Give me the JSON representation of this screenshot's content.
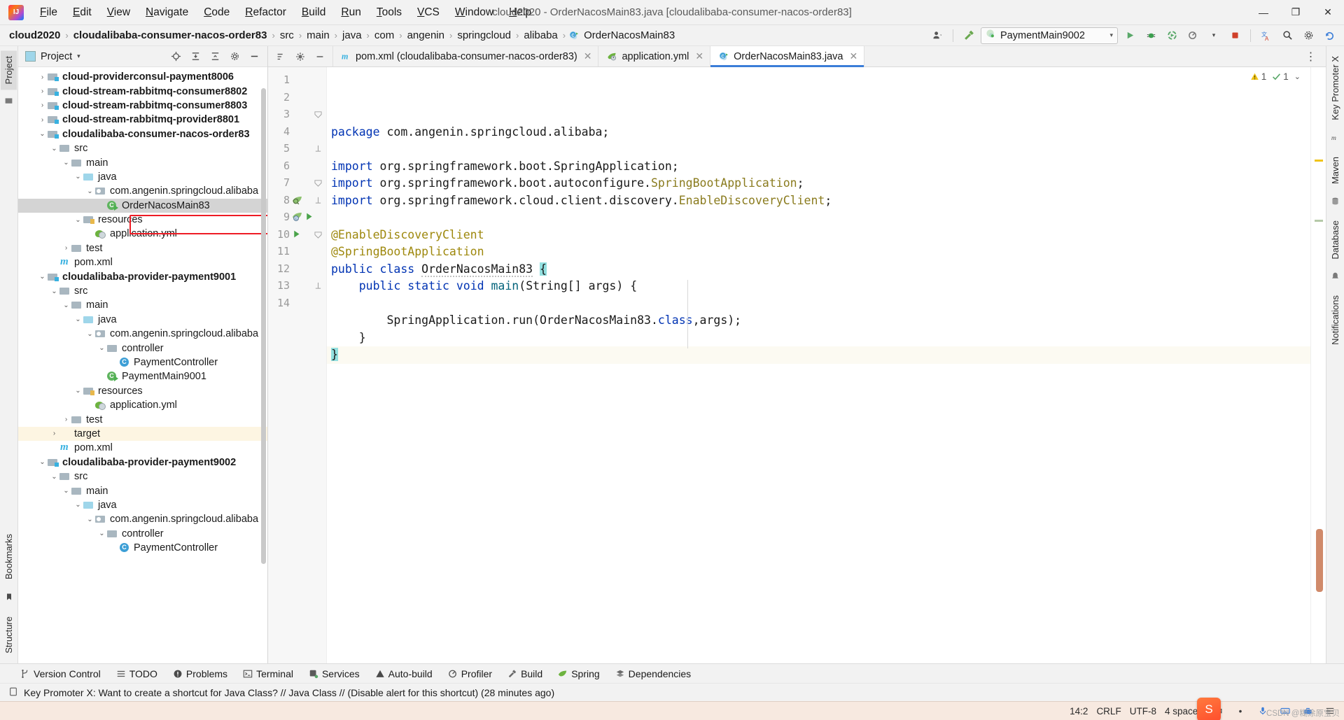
{
  "window": {
    "title": "cloud2020 - OrderNacosMain83.java [cloudalibaba-consumer-nacos-order83]",
    "minimize": "—",
    "maximize": "❐",
    "close": "✕",
    "logo_text": "IJ"
  },
  "menu": [
    {
      "label": "File"
    },
    {
      "label": "Edit"
    },
    {
      "label": "View"
    },
    {
      "label": "Navigate"
    },
    {
      "label": "Code"
    },
    {
      "label": "Refactor"
    },
    {
      "label": "Build"
    },
    {
      "label": "Run"
    },
    {
      "label": "Tools"
    },
    {
      "label": "VCS"
    },
    {
      "label": "Window"
    },
    {
      "label": "Help"
    }
  ],
  "breadcrumb": {
    "items": [
      {
        "label": "cloud2020",
        "bold": true
      },
      {
        "label": "cloudalibaba-consumer-nacos-order83",
        "bold": true
      },
      {
        "label": "src",
        "bold": false
      },
      {
        "label": "main",
        "bold": false
      },
      {
        "label": "java",
        "bold": false
      },
      {
        "label": "com",
        "bold": false
      },
      {
        "label": "angenin",
        "bold": false
      },
      {
        "label": "springcloud",
        "bold": false
      },
      {
        "label": "alibaba",
        "bold": false
      },
      {
        "label": "OrderNacosMain83",
        "bold": false
      }
    ],
    "separator": "›"
  },
  "toolbar": {
    "run_config": "PaymentMain9002",
    "run_config_caret": "▾",
    "user_icon": "user-account",
    "hammer_icon": "build-hammer",
    "run_icon": "▶",
    "debug_icon": "debug-bug",
    "coverage_icon": "run-with-coverage",
    "profiler_icon": "profiler",
    "stop_icon": "■",
    "translate_icon": "translate",
    "search_icon": "⌕",
    "settings_icon": "⚙",
    "updates_icon": "updates"
  },
  "left_strip": {
    "project_tab": "Project",
    "bookmarks_tab": "Bookmarks",
    "structure_tab": "Structure"
  },
  "right_strip": {
    "tabs": [
      "Key Promoter X",
      "Maven",
      "Database",
      "Notifications"
    ]
  },
  "project_panel": {
    "title": "Project",
    "caret": "▾",
    "tools": [
      "locate-icon",
      "expand-all-icon",
      "collapse-all-icon",
      "settings-icon",
      "hide-icon"
    ],
    "tree": [
      {
        "depth": 2,
        "arrow": "›",
        "icon": "module",
        "label": "cloud-providerconsul-payment8006",
        "bold": true
      },
      {
        "depth": 2,
        "arrow": "›",
        "icon": "module",
        "label": "cloud-stream-rabbitmq-consumer8802",
        "bold": true
      },
      {
        "depth": 2,
        "arrow": "›",
        "icon": "module",
        "label": "cloud-stream-rabbitmq-consumer8803",
        "bold": true
      },
      {
        "depth": 2,
        "arrow": "›",
        "icon": "module",
        "label": "cloud-stream-rabbitmq-provider8801",
        "bold": true
      },
      {
        "depth": 2,
        "arrow": "⌄",
        "icon": "module",
        "label": "cloudalibaba-consumer-nacos-order83",
        "bold": true
      },
      {
        "depth": 3,
        "arrow": "⌄",
        "icon": "folder",
        "label": "src",
        "bold": false
      },
      {
        "depth": 4,
        "arrow": "⌄",
        "icon": "folder",
        "label": "main",
        "bold": false
      },
      {
        "depth": 5,
        "arrow": "⌄",
        "icon": "src",
        "label": "java",
        "bold": false
      },
      {
        "depth": 6,
        "arrow": "⌄",
        "icon": "pkg",
        "label": "com.angenin.springcloud.alibaba",
        "bold": false
      },
      {
        "depth": 7,
        "arrow": "",
        "icon": "springcls",
        "label": "OrderNacosMain83",
        "bold": false,
        "selected": true,
        "boxed": true
      },
      {
        "depth": 5,
        "arrow": "⌄",
        "icon": "res",
        "label": "resources",
        "bold": false
      },
      {
        "depth": 6,
        "arrow": "",
        "icon": "yml",
        "label": "application.yml",
        "bold": false
      },
      {
        "depth": 4,
        "arrow": "›",
        "icon": "folder",
        "label": "test",
        "bold": false
      },
      {
        "depth": 3,
        "arrow": "",
        "icon": "mvn",
        "label": "pom.xml",
        "bold": false
      },
      {
        "depth": 2,
        "arrow": "⌄",
        "icon": "module",
        "label": "cloudalibaba-provider-payment9001",
        "bold": true
      },
      {
        "depth": 3,
        "arrow": "⌄",
        "icon": "folder",
        "label": "src",
        "bold": false
      },
      {
        "depth": 4,
        "arrow": "⌄",
        "icon": "folder",
        "label": "main",
        "bold": false
      },
      {
        "depth": 5,
        "arrow": "⌄",
        "icon": "src",
        "label": "java",
        "bold": false
      },
      {
        "depth": 6,
        "arrow": "⌄",
        "icon": "pkg",
        "label": "com.angenin.springcloud.alibaba",
        "bold": false
      },
      {
        "depth": 7,
        "arrow": "⌄",
        "icon": "folder",
        "label": "controller",
        "bold": false
      },
      {
        "depth": 8,
        "arrow": "",
        "icon": "cls",
        "label": "PaymentController",
        "bold": false
      },
      {
        "depth": 7,
        "arrow": "",
        "icon": "springcls",
        "label": "PaymentMain9001",
        "bold": false
      },
      {
        "depth": 5,
        "arrow": "⌄",
        "icon": "res",
        "label": "resources",
        "bold": false
      },
      {
        "depth": 6,
        "arrow": "",
        "icon": "yml",
        "label": "application.yml",
        "bold": false
      },
      {
        "depth": 4,
        "arrow": "›",
        "icon": "folder",
        "label": "test",
        "bold": false
      },
      {
        "depth": 3,
        "arrow": "›",
        "icon": "target",
        "label": "target",
        "bold": false,
        "highlight": true
      },
      {
        "depth": 3,
        "arrow": "",
        "icon": "mvn",
        "label": "pom.xml",
        "bold": false
      },
      {
        "depth": 2,
        "arrow": "⌄",
        "icon": "module",
        "label": "cloudalibaba-provider-payment9002",
        "bold": true
      },
      {
        "depth": 3,
        "arrow": "⌄",
        "icon": "folder",
        "label": "src",
        "bold": false
      },
      {
        "depth": 4,
        "arrow": "⌄",
        "icon": "folder",
        "label": "main",
        "bold": false
      },
      {
        "depth": 5,
        "arrow": "⌄",
        "icon": "src",
        "label": "java",
        "bold": false
      },
      {
        "depth": 6,
        "arrow": "⌄",
        "icon": "pkg",
        "label": "com.angenin.springcloud.alibaba",
        "bold": false
      },
      {
        "depth": 7,
        "arrow": "⌄",
        "icon": "folder",
        "label": "controller",
        "bold": false
      },
      {
        "depth": 8,
        "arrow": "",
        "icon": "cls",
        "label": "PaymentController",
        "bold": false
      }
    ]
  },
  "editor": {
    "tabs": [
      {
        "label": "pom.xml (cloudalibaba-consumer-nacos-order83)",
        "icon": "maven-icon",
        "active": false,
        "close": "✕"
      },
      {
        "label": "application.yml",
        "icon": "spring-yaml-icon",
        "active": false,
        "close": "✕"
      },
      {
        "label": "OrderNacosMain83.java",
        "icon": "spring-class-icon",
        "active": true,
        "close": "✕"
      }
    ],
    "inspection": {
      "warnings": "1",
      "weak_warnings": "1",
      "warn_icon": "⚠",
      "weak_icon": "✓",
      "caret": "⌄"
    },
    "lines": [
      {
        "n": "1",
        "tokens": [
          {
            "t": "package ",
            "c": "kw"
          },
          {
            "t": "com.angenin.springcloud.alibaba;",
            "c": "ident"
          }
        ]
      },
      {
        "n": "2",
        "tokens": []
      },
      {
        "n": "3",
        "fold": "minus",
        "tokens": [
          {
            "t": "import ",
            "c": "kw"
          },
          {
            "t": "org.springframework.boot.SpringApplication;",
            "c": "ident"
          }
        ]
      },
      {
        "n": "4",
        "tokens": [
          {
            "t": "import ",
            "c": "kw"
          },
          {
            "t": "org.springframework.boot.autoconfigure.",
            "c": "ident"
          },
          {
            "t": "SpringBootApplication",
            "c": "cls2"
          },
          {
            "t": ";",
            "c": "ident"
          }
        ]
      },
      {
        "n": "5",
        "fold": "end",
        "tokens": [
          {
            "t": "import ",
            "c": "kw"
          },
          {
            "t": "org.springframework.cloud.client.discovery.",
            "c": "ident"
          },
          {
            "t": "EnableDiscoveryClient",
            "c": "cls2"
          },
          {
            "t": ";",
            "c": "ident"
          }
        ]
      },
      {
        "n": "6",
        "tokens": []
      },
      {
        "n": "7",
        "fold": "minus",
        "tokens": [
          {
            "t": "@EnableDiscoveryClient",
            "c": "ann"
          }
        ]
      },
      {
        "n": "8",
        "gutter": "spring-bean",
        "fold": "end",
        "tokens": [
          {
            "t": "@SpringBootApplication",
            "c": "ann"
          }
        ]
      },
      {
        "n": "9",
        "gutter": "spring-run",
        "tokens": [
          {
            "t": "public ",
            "c": "kw"
          },
          {
            "t": "class ",
            "c": "kw"
          },
          {
            "t": "OrderNacosMain83",
            "c": "ident wavy"
          },
          {
            "t": " ",
            "c": "ident"
          },
          {
            "t": "{",
            "c": "brace-hl"
          }
        ]
      },
      {
        "n": "10",
        "gutter": "run",
        "fold": "minus",
        "tokens": [
          {
            "t": "    public ",
            "c": "kw"
          },
          {
            "t": "static ",
            "c": "kw"
          },
          {
            "t": "void ",
            "c": "kw"
          },
          {
            "t": "main",
            "c": "meth"
          },
          {
            "t": "(",
            "c": "ident"
          },
          {
            "t": "String",
            "c": "ident"
          },
          {
            "t": "[] args) {",
            "c": "ident"
          }
        ]
      },
      {
        "n": "11",
        "tokens": []
      },
      {
        "n": "12",
        "tokens": [
          {
            "t": "        SpringApplication.",
            "c": "ident"
          },
          {
            "t": "run",
            "c": "ident"
          },
          {
            "t": "(OrderNacosMain83.",
            "c": "ident"
          },
          {
            "t": "class",
            "c": "kw"
          },
          {
            "t": ",args);",
            "c": "ident"
          }
        ]
      },
      {
        "n": "13",
        "fold": "end",
        "tokens": [
          {
            "t": "    }",
            "c": "ident"
          }
        ]
      },
      {
        "n": "14",
        "current": true,
        "tokens": [
          {
            "t": "}",
            "c": "brace-hl"
          }
        ]
      }
    ]
  },
  "tool_windows": [
    {
      "label": "Version Control",
      "icon": "branch-icon"
    },
    {
      "label": "TODO",
      "icon": "todo-icon"
    },
    {
      "label": "Problems",
      "icon": "problems-icon"
    },
    {
      "label": "Terminal",
      "icon": "terminal-icon"
    },
    {
      "label": "Services",
      "icon": "services-icon"
    },
    {
      "label": "Auto-build",
      "icon": "autobuild-icon"
    },
    {
      "label": "Profiler",
      "icon": "profiler-icon"
    },
    {
      "label": "Build",
      "icon": "build-icon"
    },
    {
      "label": "Spring",
      "icon": "spring-icon"
    },
    {
      "label": "Dependencies",
      "icon": "dependencies-icon"
    }
  ],
  "notification": {
    "icon": "key-promoter-icon",
    "text": "Key Promoter X: Want to create a shortcut for Java Class? // Java Class // (Disable alert for this shortcut) (28 minutes ago)"
  },
  "statusbar": {
    "caret_position": "14:2",
    "line_separator": "CRLF",
    "encoding": "UTF-8",
    "indent": "4 spaces",
    "ime_lang": "中",
    "ime_mode": "•",
    "mic_icon": "microphone",
    "keyboard_icon": "keyboard",
    "toolbox_icon": "toolbox",
    "menu_icon": "menu",
    "sogou_icon": "S",
    "watermark": "CSDN @糊涂原宝贝"
  },
  "colors": {
    "accent_blue": "#3b7dd8",
    "keyword_blue": "#0033b3",
    "annotation_gold": "#9e880d",
    "method_teal": "#00627a",
    "brace_highlight": "#93e0e0",
    "selection_gray": "#d4d4d4",
    "annotation_red": "#ee1c25",
    "status_bg": "#f7e9e0"
  }
}
